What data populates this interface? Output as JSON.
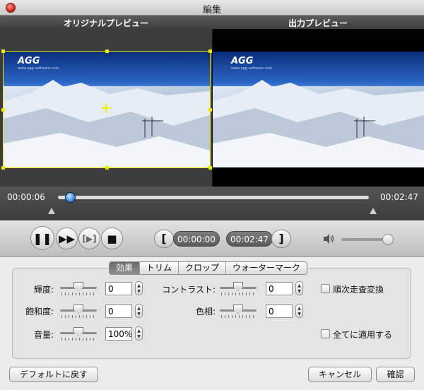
{
  "window": {
    "title": "編集"
  },
  "preview": {
    "original_label": "オリジナルプレビュー",
    "output_label": "出力プレビュー",
    "logo_text": "AGG",
    "logo_subtext": "www.agg-software.com"
  },
  "timeline": {
    "current_time": "00:00:06",
    "total_time": "00:02:47",
    "progress": 0.036
  },
  "controls": {
    "start_time": "00:00:00",
    "end_time": "00:02:47",
    "start_bracket": "[",
    "end_bracket": "]",
    "volume_level": 0.85
  },
  "tabs": [
    {
      "label": "効果",
      "active": true
    },
    {
      "label": "トリム",
      "active": false
    },
    {
      "label": "クロップ",
      "active": false
    },
    {
      "label": "ウォーターマーク",
      "active": false
    }
  ],
  "effects": {
    "brightness": {
      "label": "輝度:",
      "value": "0"
    },
    "saturation": {
      "label": "飽和度:",
      "value": "0"
    },
    "volume": {
      "label": "音量:",
      "value": "100%"
    },
    "contrast": {
      "label": "コントラスト:",
      "value": "0"
    },
    "hue": {
      "label": "色相:",
      "value": "0"
    },
    "deinterlace": {
      "label": "順次走査変換",
      "checked": false
    },
    "apply_all": {
      "label": "全てに適用する",
      "checked": false
    }
  },
  "buttons": {
    "reset": "デフォルトに戻す",
    "cancel": "キャンセル",
    "ok": "確認"
  }
}
